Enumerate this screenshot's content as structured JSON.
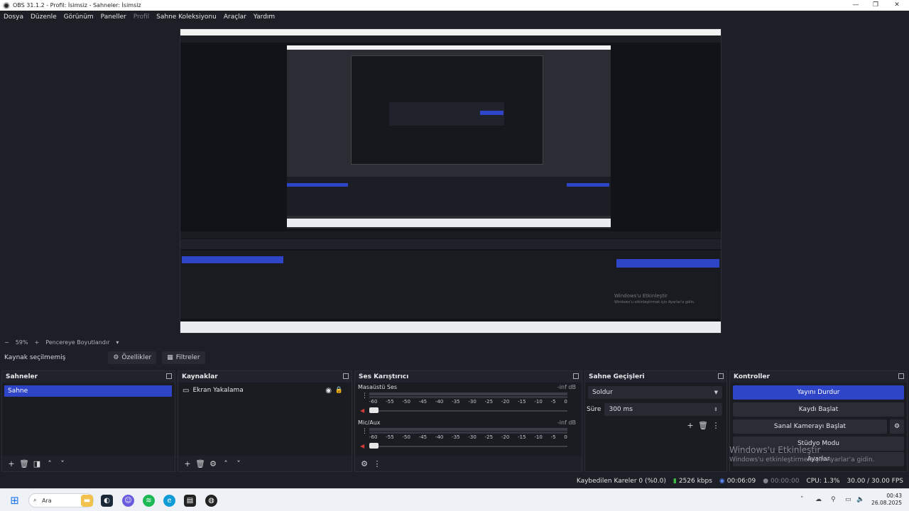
{
  "window": {
    "title": "OBS 31.1.2 - Profil: İsimsiz - Sahneler: İsimsiz"
  },
  "menu": [
    {
      "label": "Dosya",
      "enabled": true
    },
    {
      "label": "Düzenle",
      "enabled": true
    },
    {
      "label": "Görünüm",
      "enabled": true
    },
    {
      "label": "Paneller",
      "enabled": true
    },
    {
      "label": "Profil",
      "enabled": false
    },
    {
      "label": "Sahne Koleksiyonu",
      "enabled": true
    },
    {
      "label": "Araçlar",
      "enabled": true
    },
    {
      "label": "Yardım",
      "enabled": true
    }
  ],
  "zoom": {
    "minus": "−",
    "value": "59%",
    "plus": "+",
    "fit_label": "Pencereye Boyutlandır"
  },
  "context": {
    "no_source": "Kaynak seçilmemiş",
    "properties": "Özellikler",
    "filters": "Filtreler"
  },
  "scenes": {
    "title": "Sahneler",
    "items": [
      "Sahne"
    ]
  },
  "sources": {
    "title": "Kaynaklar",
    "items": [
      {
        "label": "Ekran Yakalama"
      }
    ]
  },
  "mixer": {
    "title": "Ses Karıştırıcı",
    "channels": [
      {
        "name": "Masaüstü Ses",
        "db": "-inf dB"
      },
      {
        "name": "Mic/Aux",
        "db": "-inf dB"
      }
    ],
    "scale": [
      "-60",
      "-55",
      "-50",
      "-45",
      "-40",
      "-35",
      "-30",
      "-25",
      "-20",
      "-15",
      "-10",
      "-5",
      "0"
    ]
  },
  "transitions": {
    "title": "Sahne Geçişleri",
    "selected": "Soldur",
    "duration_label": "Süre",
    "duration_value": "300 ms"
  },
  "controls": {
    "title": "Kontroller",
    "stop_stream": "Yayını Durdur",
    "start_recording": "Kaydı Başlat",
    "start_virtualcam": "Sanal Kamerayı Başlat",
    "studio_mode": "Stüdyo Modu",
    "settings": "Ayarlar"
  },
  "watermark": {
    "line1": "Windows'u Etkinleştir",
    "line2": "Windows'u etkinleştirmek için Ayarlar'a gidin."
  },
  "status": {
    "dropped_frames": "Kaybedilen Kareler 0 (%0.0)",
    "bitrate": "2526 kbps",
    "stream_time": "00:06:09",
    "rec_time": "00:00:00",
    "cpu": "CPU: 1.3%",
    "fps": "30.00 / 30.00 FPS"
  },
  "taskbar": {
    "search_label": "Ara",
    "time": "00:43",
    "date": "26.08.2025"
  },
  "colors": {
    "accent": "#2f45c8",
    "background": "#1d1f26",
    "dock": "#1a1c22"
  }
}
